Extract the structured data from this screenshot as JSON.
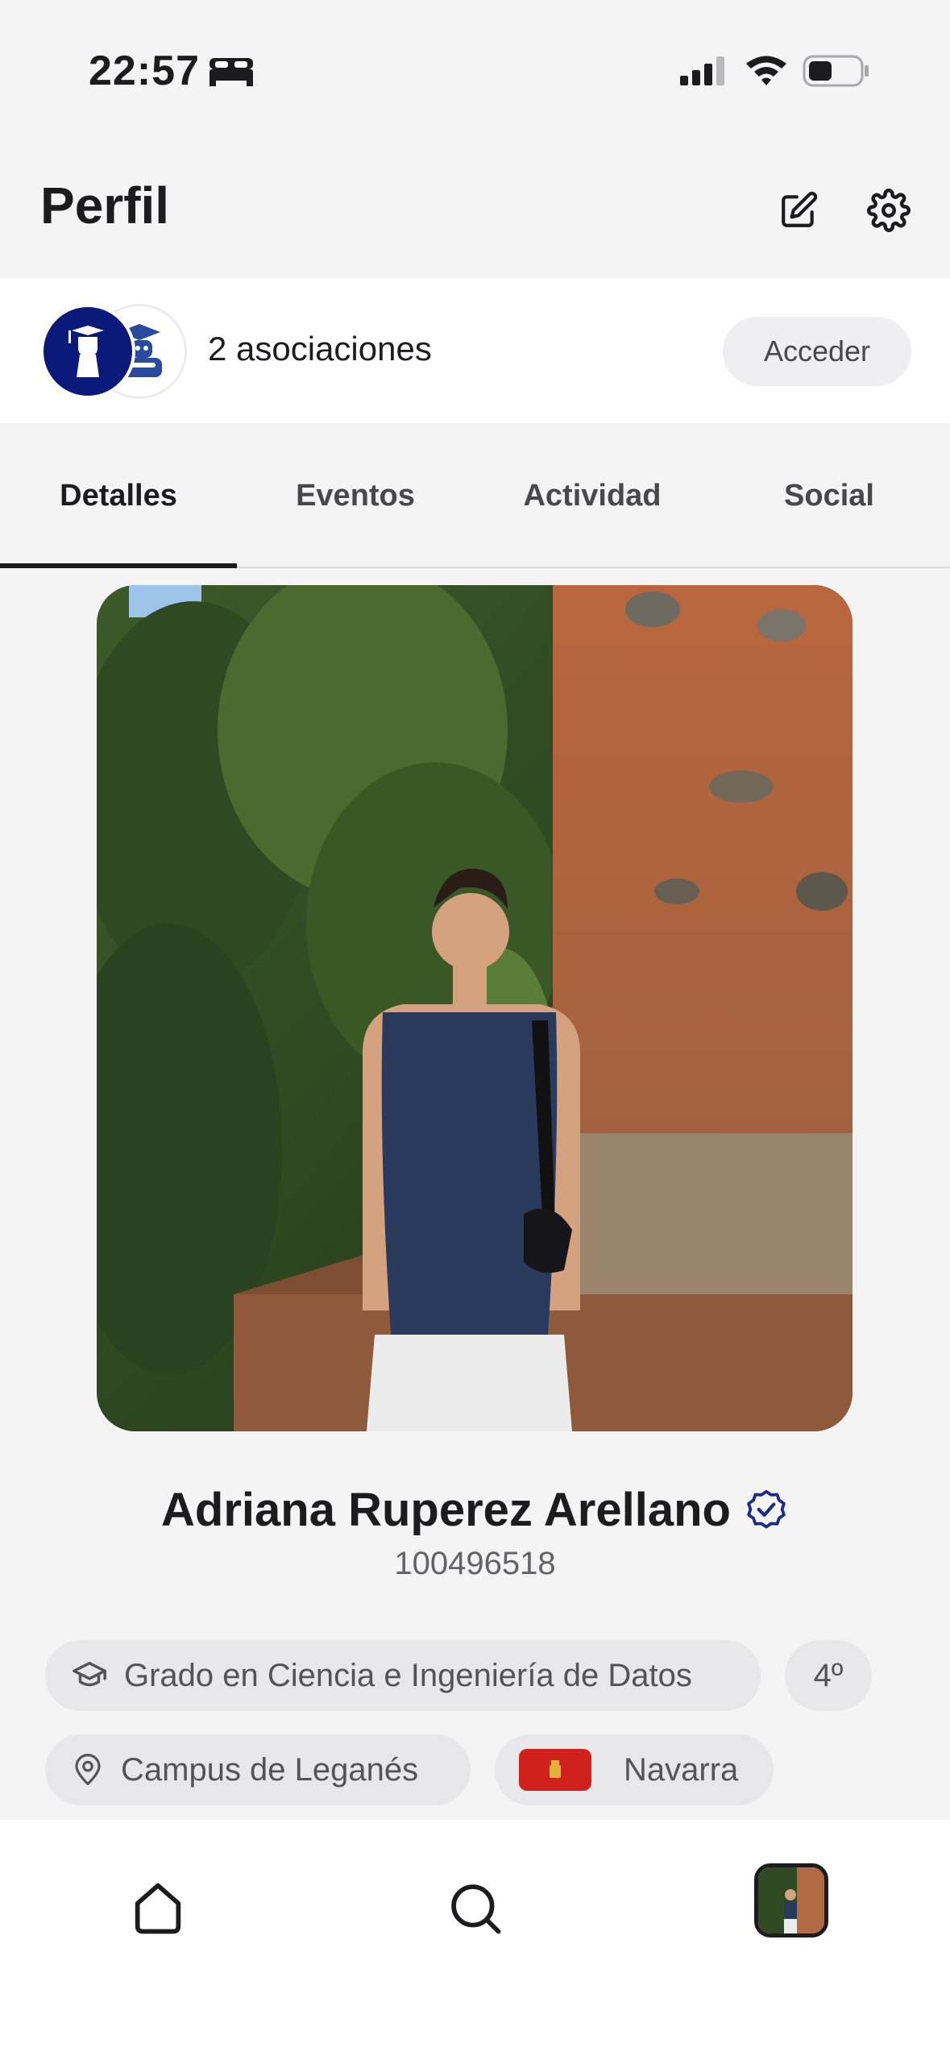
{
  "status_bar": {
    "time": "22:57",
    "icons": [
      "bed-icon",
      "signal-icon",
      "wifi-icon",
      "battery-icon"
    ]
  },
  "header": {
    "title": "Perfil",
    "icons": [
      "edit-icon",
      "settings-icon"
    ]
  },
  "associations": {
    "label": "2 asociaciones",
    "button_label": "Acceder"
  },
  "tabs": [
    {
      "label": "Detalles",
      "active": true
    },
    {
      "label": "Eventos",
      "active": false
    },
    {
      "label": "Actividad",
      "active": false
    },
    {
      "label": "Social",
      "active": false
    }
  ],
  "profile": {
    "name": "Adriana Ruperez Arellano",
    "student_id": "100496518",
    "verified": true,
    "degree": "Grado en Ciencia e Ingeniería de Datos",
    "year": "4º",
    "campus": "Campus de Leganés",
    "region": "Navarra"
  },
  "colors": {
    "accent": "#0b1a7a",
    "verified": "#1b2a8c",
    "flag": "#d0211c"
  },
  "bottom_nav": {
    "items": [
      "home-icon",
      "search-icon",
      "profile-thumbnail"
    ]
  }
}
